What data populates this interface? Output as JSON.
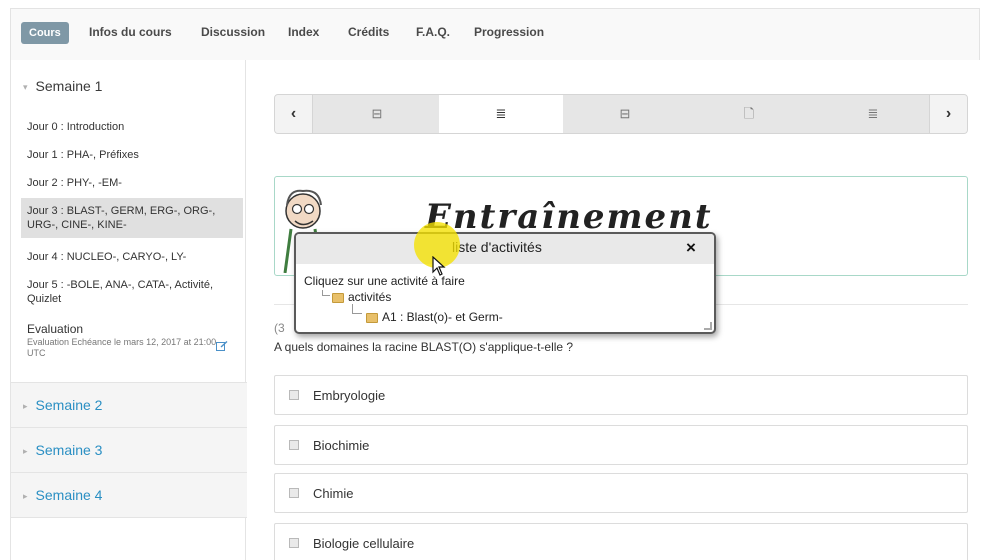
{
  "tabs": [
    {
      "label": "Cours",
      "active": true
    },
    {
      "label": "Infos du cours"
    },
    {
      "label": "Discussion"
    },
    {
      "label": "Index"
    },
    {
      "label": "Crédits"
    },
    {
      "label": "F.A.Q."
    },
    {
      "label": "Progression"
    }
  ],
  "sidebar": {
    "week1": "Semaine 1",
    "lessons": [
      "Jour 0 : Introduction",
      "Jour 1 : PHA-, Préfixes",
      "Jour 2 : PHY-, -EM-",
      "Jour 3 : BLAST-, GERM, ERG-, ORG-, URG-, CINE-, KINE-",
      "Jour 4 : NUCLEO-, CARYO-, LY-",
      "Jour 5 : -BOLE, ANA-, CATA-, Activité, Quizlet"
    ],
    "evaluation_title": "Evaluation",
    "evaluation_due": "Evaluation Echéance le mars 12, 2017 at 21:00 UTC",
    "week2": "Semaine 2",
    "week3": "Semaine 3",
    "week4": "Semaine 4"
  },
  "seqnav": {
    "prev": "‹",
    "next": "›",
    "items": [
      {
        "icon": "video-icon",
        "glyph": "⊟"
      },
      {
        "icon": "list-icon",
        "glyph": "≣",
        "active": true
      },
      {
        "icon": "video-icon",
        "glyph": "⊟"
      },
      {
        "icon": "document-icon",
        "glyph": "🗋"
      },
      {
        "icon": "list-icon",
        "glyph": "≣"
      }
    ]
  },
  "banner": {
    "title": "Entraînement"
  },
  "question": {
    "points": "(3",
    "text": "A quels domaines la racine BLAST(O) s'applique-t-elle ?",
    "choices": [
      "Embryologie",
      "Biochimie",
      "Chimie",
      "Biologie cellulaire"
    ]
  },
  "popup": {
    "title": "liste d'activités",
    "close": "×",
    "hint": "Cliquez sur une activité à faire",
    "tree_root": "activités",
    "tree_child": "A1 : Blast(o)- et Germ-"
  },
  "colors": {
    "active_tab_bg": "#7f98a6",
    "link_blue": "#2a8fc3",
    "banner_border": "#a8d8c8",
    "cursor_highlight": "#f5e100"
  }
}
